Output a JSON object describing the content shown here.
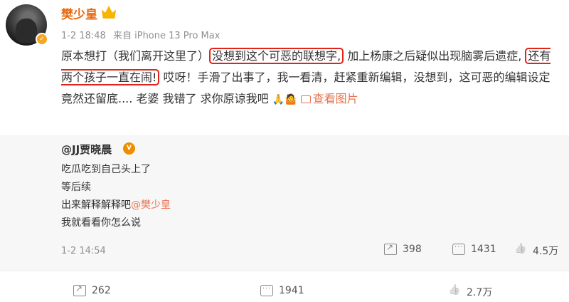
{
  "post": {
    "author": "樊少皇",
    "timestamp": "1-2 18:48",
    "source": "来自 iPhone 13 Pro Max",
    "text_segments": {
      "s1": "原本想打（我们离开这里了）",
      "h1": "没想到这个可恶的联想字,",
      "s2": " 加上杨康之后疑似出现脑雾后遗症,",
      "h2": "还有两个孩子一直在闹!",
      "s3": " 哎呀！手滑了出事了，我一看清，赶紧重新编辑，没想到，这可恶的编辑设定竟然还留底.... 老婆 我错了 求你原谅我吧 ",
      "emoji": "🙏🤷"
    },
    "view_pic_label": "查看图片"
  },
  "repost": {
    "author": "@JJ贾晓晨",
    "lines": [
      "吃瓜吃到自己头上了",
      "等后续",
      "出来解释解释吧",
      "我就看看你怎么说"
    ],
    "mention": "@樊少皇",
    "timestamp": "1-2 14:54",
    "repost_count": "398",
    "comment_count": "1431",
    "like_count": "4.5万"
  },
  "footer": {
    "repost_count": "262",
    "comment_count": "1941",
    "like_count": "2.7万"
  }
}
